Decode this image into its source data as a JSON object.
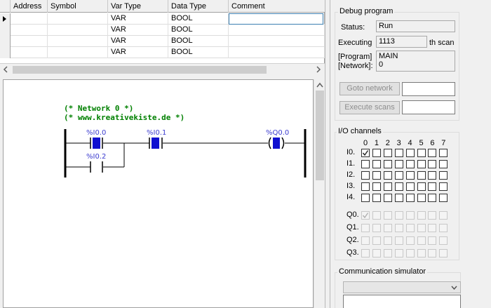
{
  "var_table": {
    "columns": [
      "Address",
      "Symbol",
      "Var Type",
      "Data Type",
      "Comment"
    ],
    "rows": [
      {
        "address": "",
        "symbol": "",
        "var_type": "VAR",
        "data_type": "BOOL",
        "comment": ""
      },
      {
        "address": "",
        "symbol": "",
        "var_type": "VAR",
        "data_type": "BOOL",
        "comment": ""
      },
      {
        "address": "",
        "symbol": "",
        "var_type": "VAR",
        "data_type": "BOOL",
        "comment": ""
      },
      {
        "address": "",
        "symbol": "",
        "var_type": "VAR",
        "data_type": "BOOL",
        "comment": ""
      }
    ]
  },
  "ladder": {
    "comment_line1": "(* Network 0 *)",
    "comment_line2": "(* www.kreativekiste.de *)",
    "contact1": "%I0.0",
    "contact2": "%I0.1",
    "contact3": "%I0.2",
    "coil": "%Q0.0",
    "colors": {
      "code": "#008000",
      "label": "#3c3ccf",
      "element": "#1010d0"
    }
  },
  "debug": {
    "title": "Debug program",
    "status_label": "Status:",
    "status_value": "Run",
    "executing_label": "Executing",
    "executing_value": "1113",
    "scan_suffix": "th scan",
    "program_label": "[Program]",
    "network_label": "[Network]:",
    "program_value": "MAIN",
    "network_value": "0",
    "goto_button": "Goto network",
    "goto_value": "",
    "execute_button": "Execute scans",
    "execute_value": ""
  },
  "io": {
    "title": "I/O channels",
    "headers": [
      "0",
      "1",
      "2",
      "3",
      "4",
      "5",
      "6",
      "7"
    ],
    "inputs": [
      {
        "label": "I0.",
        "checked": [
          true,
          false,
          false,
          false,
          false,
          false,
          false,
          false
        ]
      },
      {
        "label": "I1.",
        "checked": [
          false,
          false,
          false,
          false,
          false,
          false,
          false,
          false
        ]
      },
      {
        "label": "I2.",
        "checked": [
          false,
          false,
          false,
          false,
          false,
          false,
          false,
          false
        ]
      },
      {
        "label": "I3.",
        "checked": [
          false,
          false,
          false,
          false,
          false,
          false,
          false,
          false
        ]
      },
      {
        "label": "I4.",
        "checked": [
          false,
          false,
          false,
          false,
          false,
          false,
          false,
          false
        ]
      }
    ],
    "outputs": [
      {
        "label": "Q0.",
        "checked": [
          true,
          false,
          false,
          false,
          false,
          false,
          false,
          false
        ]
      },
      {
        "label": "Q1.",
        "checked": [
          false,
          false,
          false,
          false,
          false,
          false,
          false,
          false
        ]
      },
      {
        "label": "Q2.",
        "checked": [
          false,
          false,
          false,
          false,
          false,
          false,
          false,
          false
        ]
      },
      {
        "label": "Q3.",
        "checked": [
          false,
          false,
          false,
          false,
          false,
          false,
          false,
          false
        ]
      }
    ]
  },
  "comm": {
    "title": "Communication simulator",
    "selected": ""
  }
}
